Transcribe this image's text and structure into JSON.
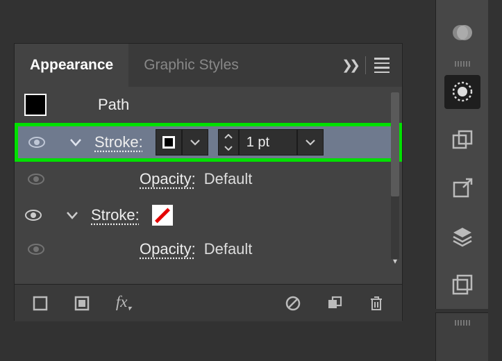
{
  "tabs": {
    "appearance": "Appearance",
    "graphic_styles": "Graphic Styles"
  },
  "path": {
    "label": "Path"
  },
  "stroke1": {
    "label": "Stroke:",
    "weight": "1 pt"
  },
  "opacity1": {
    "label": "Opacity:",
    "value": "Default"
  },
  "stroke2": {
    "label": "Stroke:"
  },
  "opacity2": {
    "label": "Opacity:",
    "value": "Default"
  },
  "footer": {
    "fx": "fx"
  }
}
